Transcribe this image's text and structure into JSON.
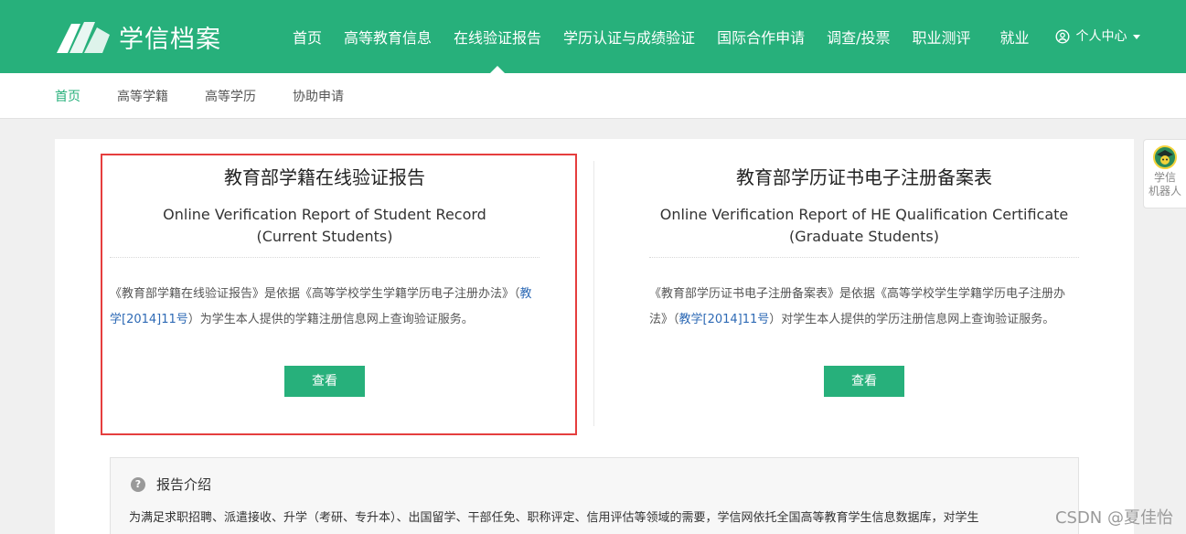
{
  "header": {
    "logo_text": "学信档案",
    "nav": [
      {
        "label": "首页"
      },
      {
        "label": "高等教育信息"
      },
      {
        "label": "在线验证报告",
        "active": true
      },
      {
        "label": "学历认证与成绩验证"
      },
      {
        "label": "国际合作申请"
      },
      {
        "label": "调查/投票"
      },
      {
        "label": "职业测评"
      },
      {
        "label": "就业"
      }
    ],
    "user_center": "个人中心"
  },
  "subnav": [
    {
      "label": "首页",
      "active": true
    },
    {
      "label": "高等学籍"
    },
    {
      "label": "高等学历"
    },
    {
      "label": "协助申请"
    }
  ],
  "reports": [
    {
      "title": "教育部学籍在线验证报告",
      "en_line1": "Online Verification Report of Student Record",
      "en_line2": "(Current Students)",
      "desc_before": "《教育部学籍在线验证报告》是依据《高等学校学生学籍学历电子注册办法》（",
      "desc_link": "教学[2014]11号",
      "desc_after": "）为学生本人提供的学籍注册信息网上查询验证服务。",
      "button": "查看"
    },
    {
      "title": "教育部学历证书电子注册备案表",
      "en_line1": "Online Verification Report of HE Qualification Certificate",
      "en_line2": "(Graduate Students)",
      "desc_before": "《教育部学历证书电子注册备案表》是依据《高等学校学生学籍学历电子注册办法》（",
      "desc_link": "教学[2014]11号",
      "desc_after": "）对学生本人提供的学历注册信息网上查询验证服务。",
      "button": "查看"
    }
  ],
  "intro": {
    "title": "报告介绍",
    "text": "为满足求职招聘、派遣接收、升学（考研、专升本）、出国留学、干部任免、职称评定、信用评估等领域的需要，学信网依托全国高等教育学生信息数据库，对学生"
  },
  "robot": {
    "line1": "学信",
    "line2": "机器人"
  },
  "watermark": "CSDN @夏佳怡",
  "colors": {
    "brand_green": "#27b07b",
    "link_blue": "#2e6ab5",
    "highlight_red": "#e53e3e"
  }
}
